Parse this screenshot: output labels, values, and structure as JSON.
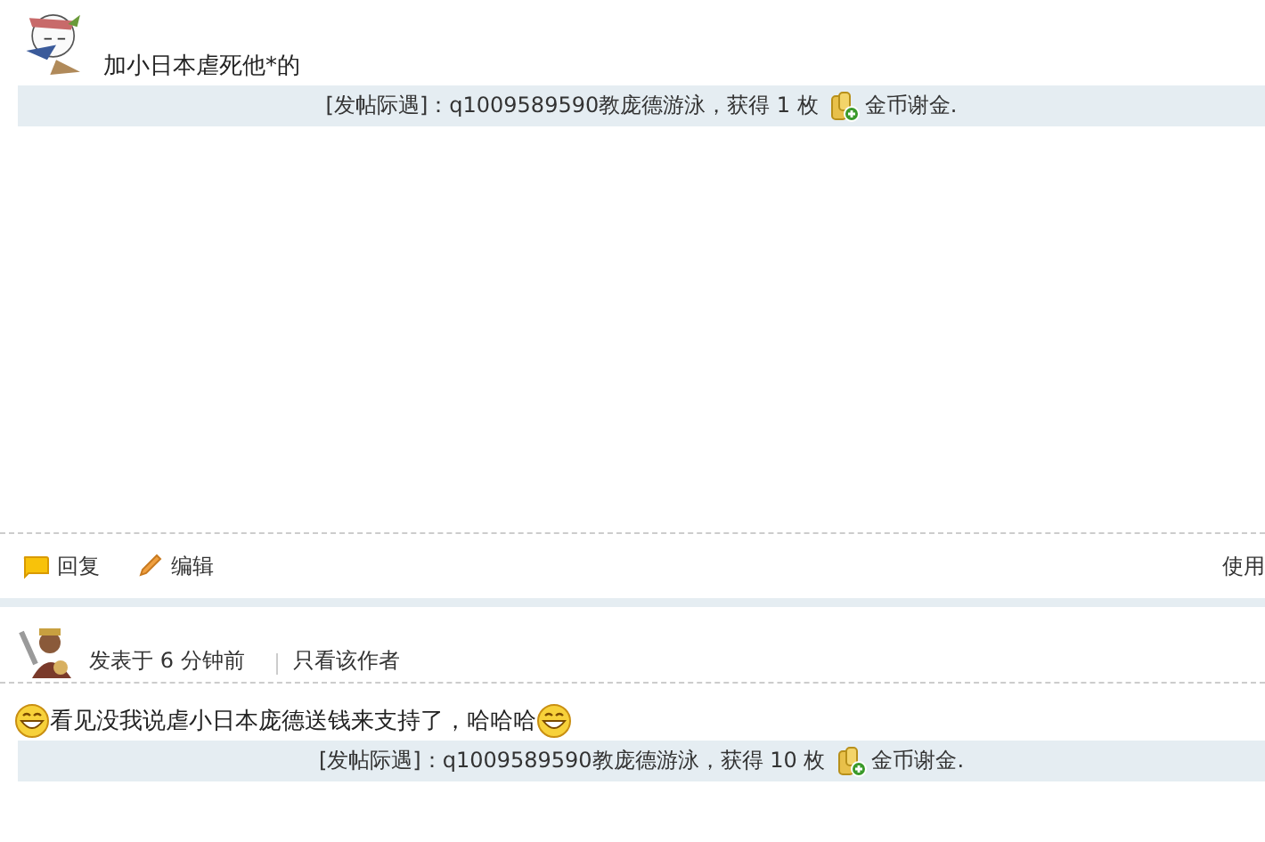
{
  "posts": [
    {
      "body": [
        {
          "kind": "text",
          "text": "加小日本虐死他*的"
        }
      ],
      "reward": {
        "before": "[发帖际遇]：q1009589590教庞德游泳，获得 1 枚",
        "after": "金币谢金."
      },
      "actions": [
        {
          "kind": "reply",
          "label": "回复"
        },
        {
          "kind": "edit",
          "label": "编辑"
        }
      ],
      "right_action": "使用"
    },
    {
      "header": {
        "posted": "发表于 6 分钟前",
        "author_only": "只看该作者"
      },
      "body": [
        {
          "kind": "emoji"
        },
        {
          "kind": "text",
          "text": "看见没我说虐小日本庞德送钱来支持了，哈哈哈"
        },
        {
          "kind": "emoji"
        }
      ],
      "reward": {
        "before": "[发帖际遇]：q1009589590教庞德游泳，获得 10 枚",
        "after": "金币谢金."
      }
    }
  ]
}
